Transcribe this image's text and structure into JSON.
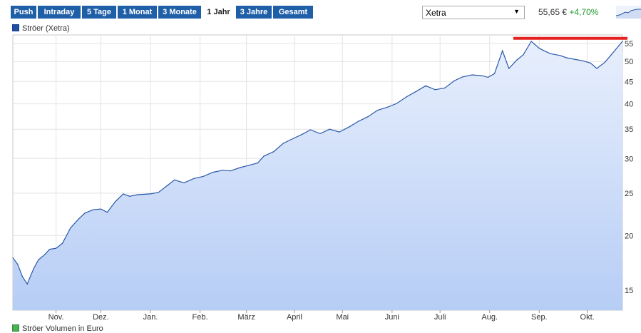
{
  "tabs": [
    {
      "label": "Push",
      "active": false
    },
    {
      "label": "Intraday",
      "active": false
    },
    {
      "label": "5 Tage",
      "active": false
    },
    {
      "label": "1 Monat",
      "active": false
    },
    {
      "label": "3 Monate",
      "active": false
    },
    {
      "label": "1 Jahr",
      "active": true
    },
    {
      "label": "3 Jahre",
      "active": false
    },
    {
      "label": "Gesamt",
      "active": false
    }
  ],
  "exchange": {
    "selected": "Xetra"
  },
  "quote": {
    "price": "55,65 €",
    "change": "+4,70%"
  },
  "legend": {
    "series": "Ströer (Xetra)",
    "volume": "Ströer Volumen in Euro"
  },
  "colors": {
    "tab": "#1f5fa8",
    "line": "#2a58a8",
    "area_top": "#e8effd",
    "area_bottom": "#b6cdf5",
    "marker": "#e52222",
    "change": "#1a9b2b"
  },
  "chart_data": {
    "type": "area",
    "scale": "log",
    "grid": true,
    "ylim": [
      13.5,
      57.5
    ],
    "yticks": [
      15,
      20,
      25,
      30,
      35,
      40,
      45,
      50,
      55
    ],
    "xlim": [
      "2014-10-07",
      "2015-10-23"
    ],
    "xticks": [
      {
        "label": "Nov.",
        "date": "2014-11-03"
      },
      {
        "label": "Dez.",
        "date": "2014-12-01"
      },
      {
        "label": "Jan.",
        "date": "2015-01-01"
      },
      {
        "label": "Feb.",
        "date": "2015-02-01"
      },
      {
        "label": "März",
        "date": "2015-03-02"
      },
      {
        "label": "April",
        "date": "2015-04-01"
      },
      {
        "label": "Mai",
        "date": "2015-05-01"
      },
      {
        "label": "Juni",
        "date": "2015-06-01"
      },
      {
        "label": "Juli",
        "date": "2015-07-01"
      },
      {
        "label": "Aug.",
        "date": "2015-08-01"
      },
      {
        "label": "Sep.",
        "date": "2015-09-01"
      },
      {
        "label": "Okt.",
        "date": "2015-10-01"
      }
    ],
    "series": [
      {
        "x": [
          "2014-10-07",
          "2014-10-10",
          "2014-10-13",
          "2014-10-16",
          "2014-10-20",
          "2014-10-23",
          "2014-10-27",
          "2014-10-30",
          "2014-11-03",
          "2014-11-07",
          "2014-11-12",
          "2014-11-17",
          "2014-11-21",
          "2014-11-26",
          "2014-12-01",
          "2014-12-05",
          "2014-12-10",
          "2014-12-15",
          "2014-12-19",
          "2014-12-24",
          "2015-01-01",
          "2015-01-06",
          "2015-01-12",
          "2015-01-16",
          "2015-01-22",
          "2015-01-28",
          "2015-02-03",
          "2015-02-09",
          "2015-02-15",
          "2015-02-20",
          "2015-02-26",
          "2015-03-03",
          "2015-03-09",
          "2015-03-13",
          "2015-03-19",
          "2015-03-25",
          "2015-03-31",
          "2015-04-06",
          "2015-04-11",
          "2015-04-17",
          "2015-04-23",
          "2015-04-29",
          "2015-05-05",
          "2015-05-11",
          "2015-05-17",
          "2015-05-23",
          "2015-05-29",
          "2015-06-04",
          "2015-06-10",
          "2015-06-16",
          "2015-06-22",
          "2015-06-28",
          "2015-07-04",
          "2015-07-10",
          "2015-07-15",
          "2015-07-21",
          "2015-07-27",
          "2015-07-31",
          "2015-08-04",
          "2015-08-09",
          "2015-08-13",
          "2015-08-18",
          "2015-08-22",
          "2015-08-27",
          "2015-09-01",
          "2015-09-04",
          "2015-09-08",
          "2015-09-14",
          "2015-09-18",
          "2015-09-23",
          "2015-09-28",
          "2015-10-03",
          "2015-10-07",
          "2015-10-12",
          "2015-10-16",
          "2015-10-23"
        ],
        "values": [
          17.8,
          17.2,
          16.1,
          15.5,
          16.8,
          17.6,
          18.1,
          18.6,
          18.7,
          19.2,
          20.8,
          21.8,
          22.5,
          22.9,
          23.0,
          22.6,
          23.9,
          24.9,
          24.6,
          24.8,
          24.9,
          25.1,
          26.1,
          26.8,
          26.4,
          27.0,
          27.3,
          27.9,
          28.2,
          28.1,
          28.6,
          28.9,
          29.3,
          30.4,
          31.1,
          32.5,
          33.3,
          34.1,
          34.9,
          34.2,
          35.0,
          34.5,
          35.4,
          36.5,
          37.4,
          38.7,
          39.3,
          40.1,
          41.5,
          42.7,
          44.0,
          43.1,
          43.5,
          45.2,
          46.1,
          46.6,
          46.4,
          46.0,
          46.9,
          52.9,
          48.2,
          50.4,
          51.8,
          55.6,
          53.6,
          52.9,
          52.1,
          51.6,
          51.0,
          50.6,
          50.2,
          49.6,
          48.2,
          49.8,
          51.8,
          55.6
        ]
      }
    ],
    "reference_line": {
      "value": 55.65
    }
  }
}
